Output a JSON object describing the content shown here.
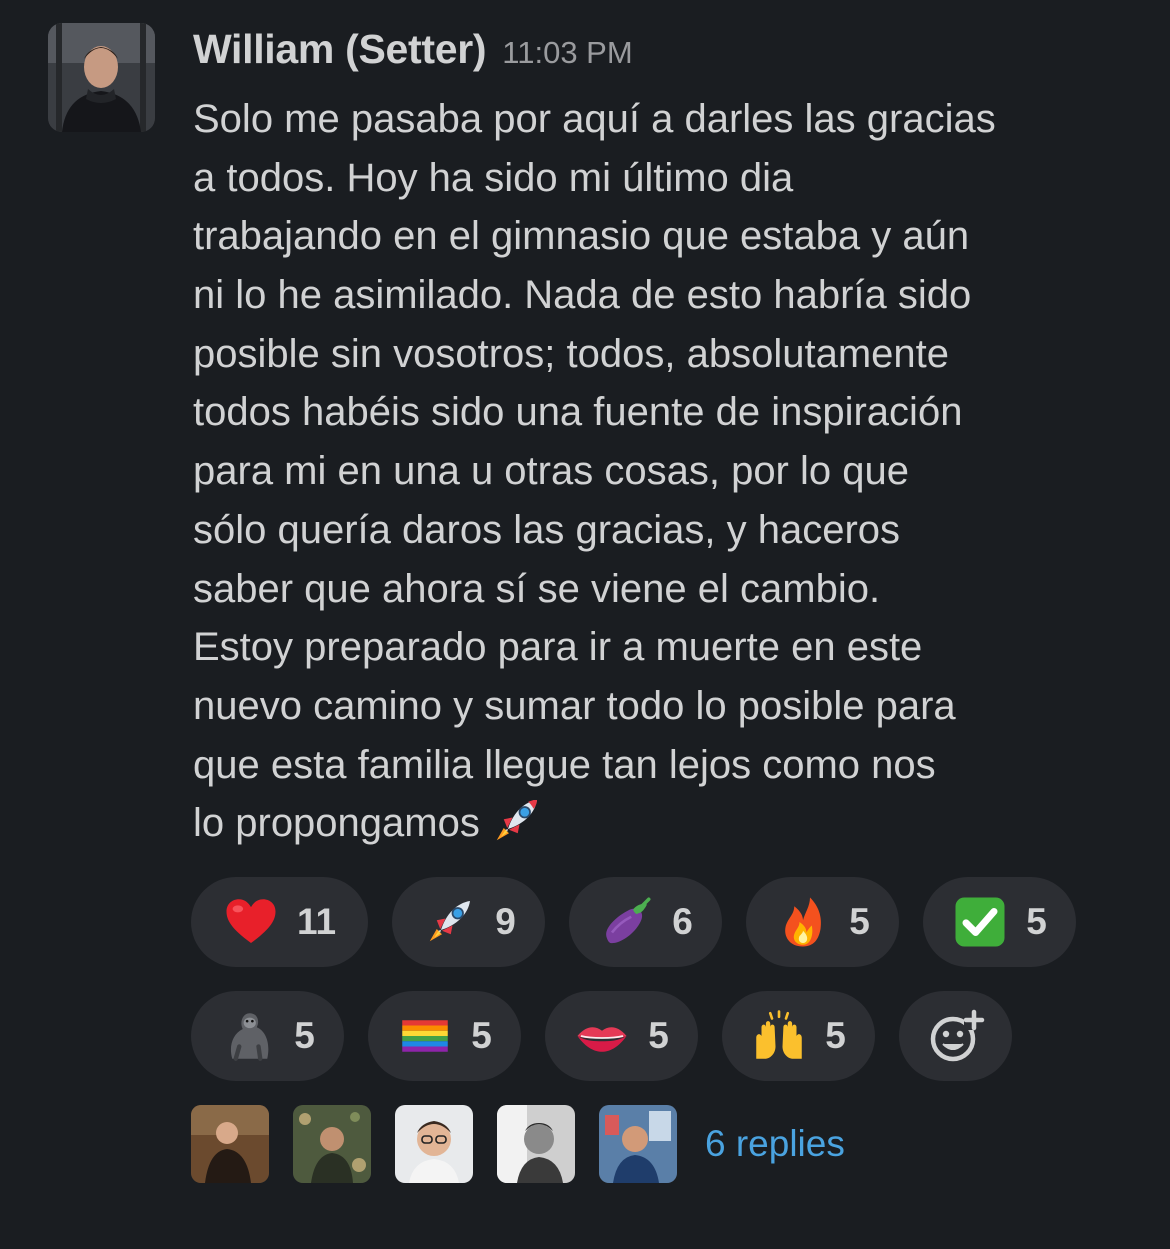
{
  "message": {
    "author": "William (Setter)",
    "timestamp": "11:03 PM",
    "lines": [
      "Solo me pasaba por aquí a darles las gracias",
      "a todos. Hoy ha sido mi último dia",
      "trabajando en el gimnasio que estaba y aún",
      "ni lo he asimilado. Nada de esto habría sido",
      "posible sin vosotros; todos, absolutamente",
      "todos habéis sido una fuente de inspiración",
      "para mi en una u otras cosas, por lo que",
      "sólo quería daros las gracias, y haceros",
      "saber que ahora sí se viene el cambio.",
      "Estoy preparado para ir a muerte en este",
      "nuevo camino y sumar todo lo posible para",
      "que esta familia llegue tan lejos como nos",
      "lo propongamos"
    ],
    "trailing_emoji": "rocket"
  },
  "reactions": [
    {
      "emoji": "heart",
      "count": "11"
    },
    {
      "emoji": "rocket",
      "count": "9"
    },
    {
      "emoji": "eggplant",
      "count": "6"
    },
    {
      "emoji": "fire",
      "count": "5"
    },
    {
      "emoji": "white-check-mark",
      "count": "5"
    },
    {
      "emoji": "gorilla",
      "count": "5"
    },
    {
      "emoji": "rainbow-flag",
      "count": "5"
    },
    {
      "emoji": "lips",
      "count": "5"
    },
    {
      "emoji": "raised-hands",
      "count": "5"
    }
  ],
  "add_reaction_icon": "add-reaction-icon",
  "thread": {
    "replies_label": "6 replies",
    "participant_count": 5
  },
  "colors": {
    "background": "#1a1d21",
    "text": "#d1d2d3",
    "muted": "#9a9b9e",
    "pill": "#2c2e33",
    "link": "#4aa3e0"
  }
}
